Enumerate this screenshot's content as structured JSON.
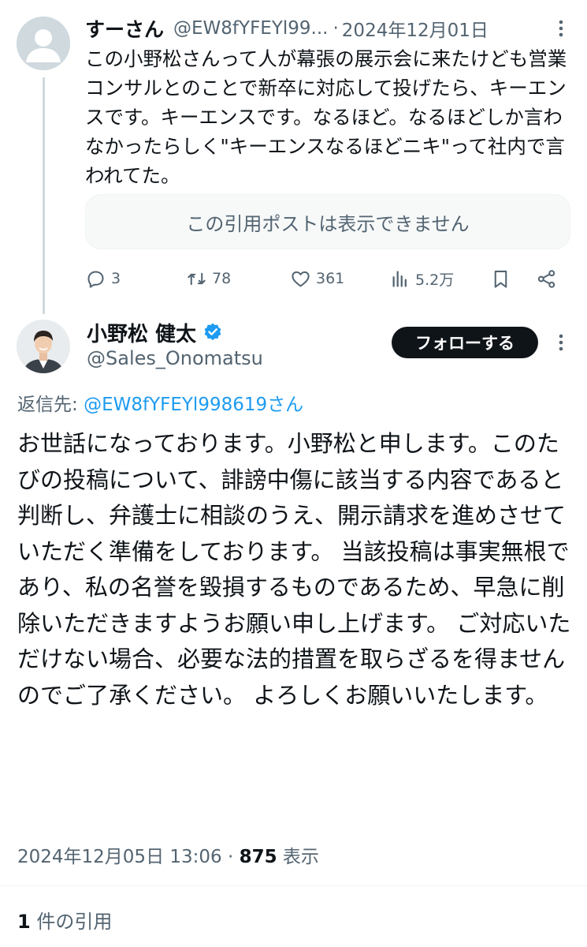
{
  "parent_tweet": {
    "display_name": "すーさん",
    "handle": "@EW8fYFEYl99...",
    "separator": "·",
    "date": "2024年12月01日",
    "text": "この小野松さんって人が幕張の展示会に来たけども営業コンサルとのことで新卒に対応して投げたら、キーエンスです。キーエンスです。なるほど。なるほどしか言わなかったらしく\"キーエンスなるほどニキ\"って社内で言われてた。",
    "quote_unavailable": "この引用ポストは表示できません",
    "replies": "3",
    "reposts": "78",
    "likes": "361",
    "views": "5.2万"
  },
  "main_tweet": {
    "display_name": "小野松 健太",
    "handle": "@Sales_Onomatsu",
    "follow_label": "フォローする",
    "reply_prefix": "返信先: ",
    "reply_to": "@EW8fYFEYl998619さん",
    "text": "お世話になっております。小野松と申します。このたびの投稿について、誹謗中傷に該当する内容であると判断し、弁護士に相談のうえ、開示請求を進めさせていただく準備をしております。 当該投稿は事実無根であり、私の名誉を毀損するものであるため、早急に削除いただきますようお願い申し上げます。 ご対応いただけない場合、必要な法的措置を取らざるを得ませんのでご了承ください。 よろしくお願いいたします。",
    "timestamp": "2024年12月05日 13:06 · ",
    "view_count": "875",
    "view_label": " 表示",
    "quote_count": "1",
    "quote_label": " 件の引用"
  },
  "colors": {
    "text": "#0f1419",
    "secondary": "#536471",
    "link": "#1d9bf0",
    "verified": "#1d9bf0",
    "button": "#0f1419"
  }
}
